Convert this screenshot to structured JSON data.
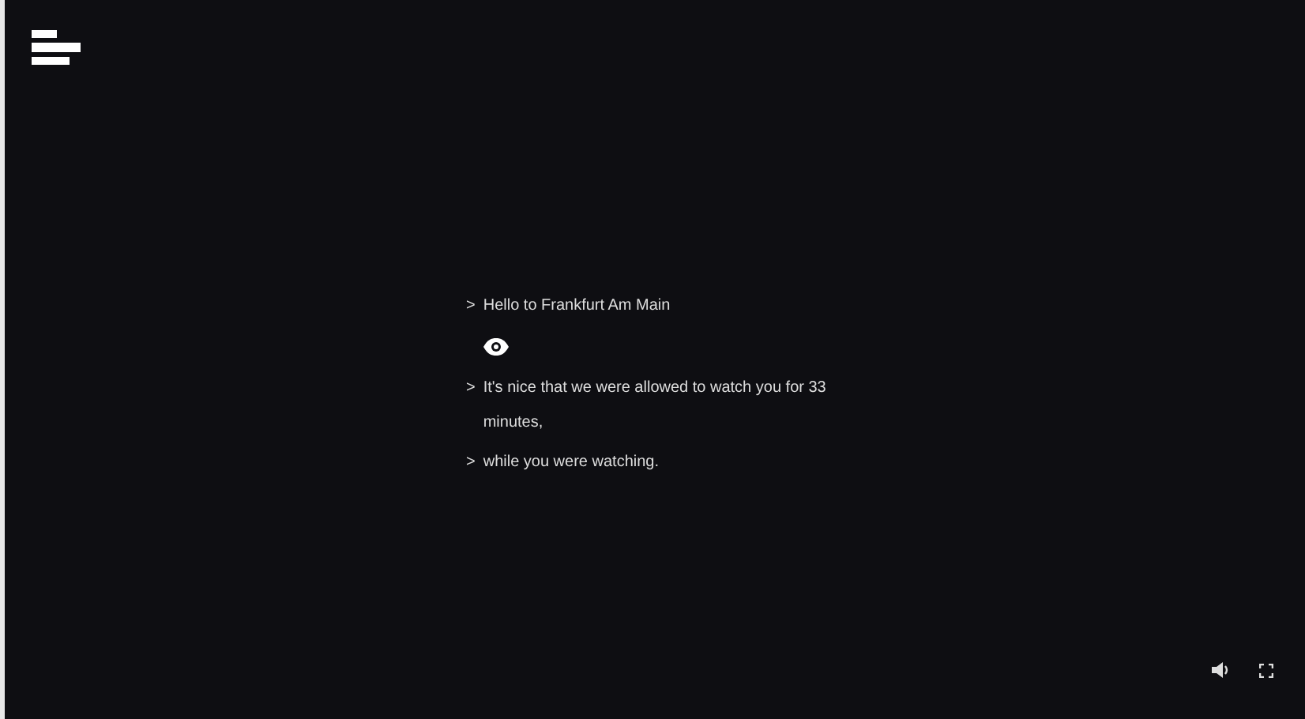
{
  "log": [
    {
      "kind": "text",
      "prompt": ">",
      "text": "Hello to Frankfurt Am Main"
    },
    {
      "kind": "eye"
    },
    {
      "kind": "text",
      "prompt": ">",
      "text": "It's nice that we were allowed to watch you for 33 minutes,"
    },
    {
      "kind": "text",
      "prompt": ">",
      "text": "while you were watching."
    }
  ]
}
